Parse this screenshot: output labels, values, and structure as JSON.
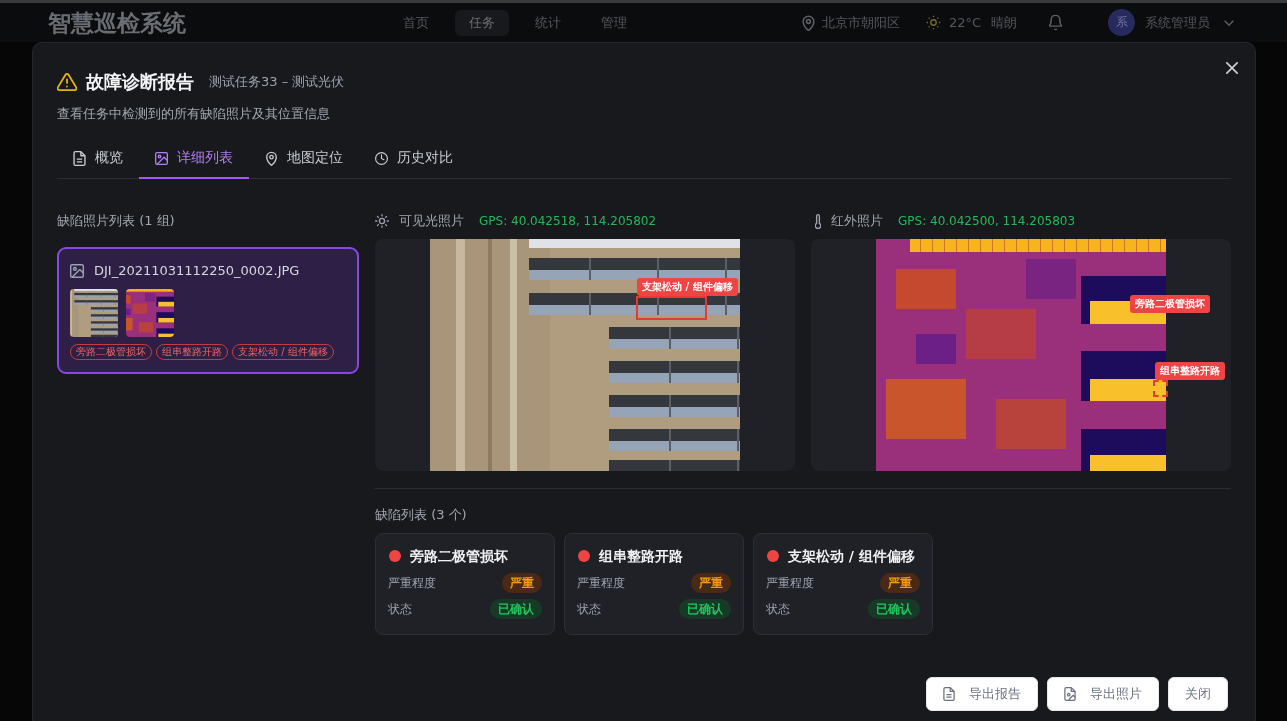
{
  "nav": {
    "logo": "智慧巡检系统",
    "menu": [
      {
        "label": "首页",
        "selected": false
      },
      {
        "label": "任务",
        "selected": true
      },
      {
        "label": "统计",
        "selected": false
      },
      {
        "label": "管理",
        "selected": false
      }
    ],
    "location": "北京市朝阳区",
    "temperature": "22°C",
    "weather": "晴朗",
    "avatar": "系",
    "user": "系统管理员"
  },
  "dialog": {
    "title": "故障诊断报告",
    "subtitle": "测试任务33 – 测试光伏",
    "description": "查看任务中检测到的所有缺陷照片及其位置信息",
    "tabs": [
      {
        "label": "概览",
        "selected": false
      },
      {
        "label": "详细列表",
        "selected": true
      },
      {
        "label": "地图定位",
        "selected": false
      },
      {
        "label": "历史对比",
        "selected": false
      }
    ]
  },
  "photo_list": {
    "heading": "缺陷照片列表 (1 组)",
    "items": [
      {
        "filename": "DJI_20211031112250_0002.JPG",
        "selected": true,
        "tags": [
          "旁路二极管损坏",
          "组串整路开路",
          "支架松动 / 组件偏移"
        ]
      }
    ]
  },
  "viewers": [
    {
      "kind": "visible",
      "title": "可见光照片",
      "gps": "GPS: 40.042518, 114.205802",
      "annotations": [
        "支架松动 / 组件偏移"
      ]
    },
    {
      "kind": "infrared",
      "title": "红外照片",
      "gps": "GPS: 40.042500, 114.205803",
      "annotations": [
        "旁路二极管损坏",
        "组串整路开路"
      ]
    }
  ],
  "defects": {
    "heading": "缺陷列表 (3 个)",
    "items": [
      {
        "name": "旁路二极管损坏",
        "severity_label": "严重程度",
        "severity": "严重",
        "status_label": "状态",
        "status": "已确认"
      },
      {
        "name": "组串整路开路",
        "severity_label": "严重程度",
        "severity": "严重",
        "status_label": "状态",
        "status": "已确认"
      },
      {
        "name": "支架松动 / 组件偏移",
        "severity_label": "严重程度",
        "severity": "严重",
        "status_label": "状态",
        "status": "已确认"
      }
    ]
  },
  "footer_buttons": [
    "导出报告",
    "导出照片",
    "关闭"
  ]
}
